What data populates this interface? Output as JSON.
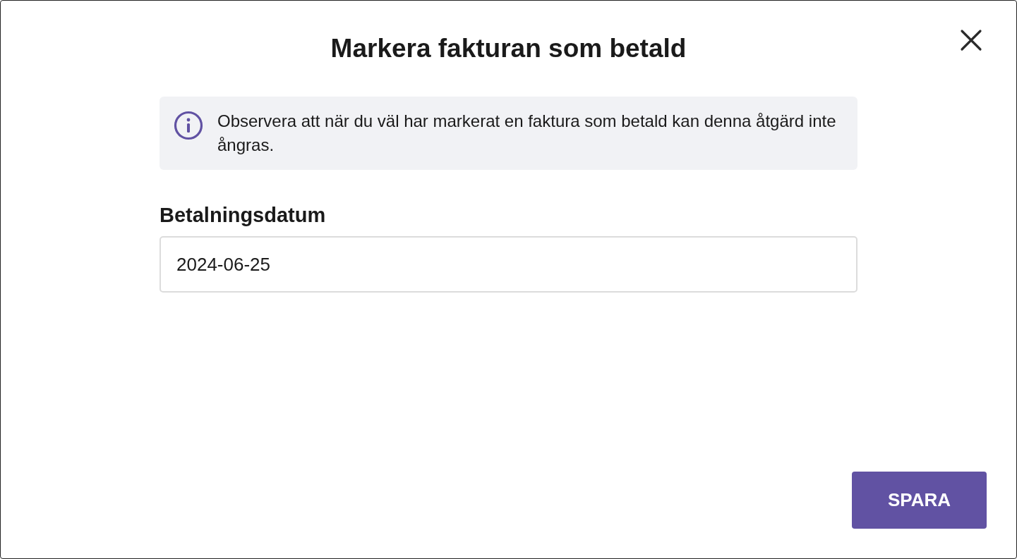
{
  "dialog": {
    "title": "Markera fakturan som betald"
  },
  "notice": {
    "text": "Observera att när du väl har markerat en faktura som betald kan denna åtgärd inte ångras."
  },
  "field": {
    "label": "Betalningsdatum",
    "value": "2024-06-25"
  },
  "buttons": [
    {
      "label": "SPARA",
      "kind": "primary"
    }
  ]
}
